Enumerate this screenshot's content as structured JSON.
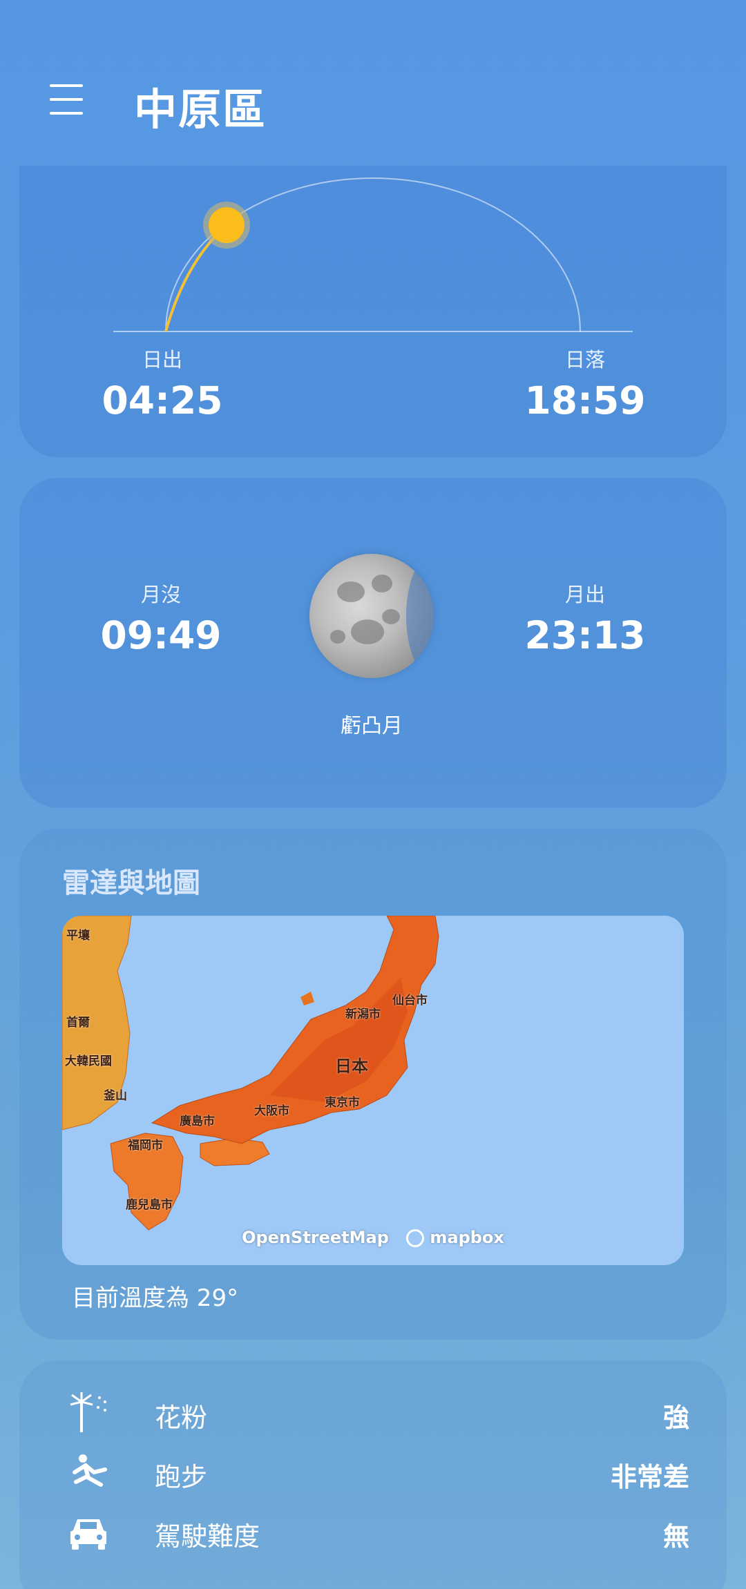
{
  "header": {
    "title": "中原區",
    "menu_icon": "menu-icon"
  },
  "sun": {
    "sunrise_label": "日出",
    "sunrise_time": "04:25",
    "sunset_label": "日落",
    "sunset_time": "18:59",
    "sun_color": "#fbbd1c"
  },
  "moon": {
    "moonset_label": "月沒",
    "moonset_time": "09:49",
    "moonrise_label": "月出",
    "moonrise_time": "23:13",
    "phase": "虧凸月"
  },
  "radar": {
    "title": "雷達與地圖",
    "attribution_osm": "OpenStreetMap",
    "attribution_mapbox": "mapbox",
    "cities": [
      "新潟市",
      "仙台市",
      "日本",
      "大阪市",
      "東京市",
      "廣島市",
      "福岡市",
      "鹿兒島市",
      "首爾",
      "大韓民國",
      "釜山",
      "平壤"
    ],
    "temperature_text": "目前溫度為 29°"
  },
  "indices": [
    {
      "icon": "pollen-icon",
      "name": "花粉",
      "value": "強"
    },
    {
      "icon": "running-icon",
      "name": "跑步",
      "value": "非常差"
    },
    {
      "icon": "car-icon",
      "name": "駕駛難度",
      "value": "無"
    }
  ]
}
